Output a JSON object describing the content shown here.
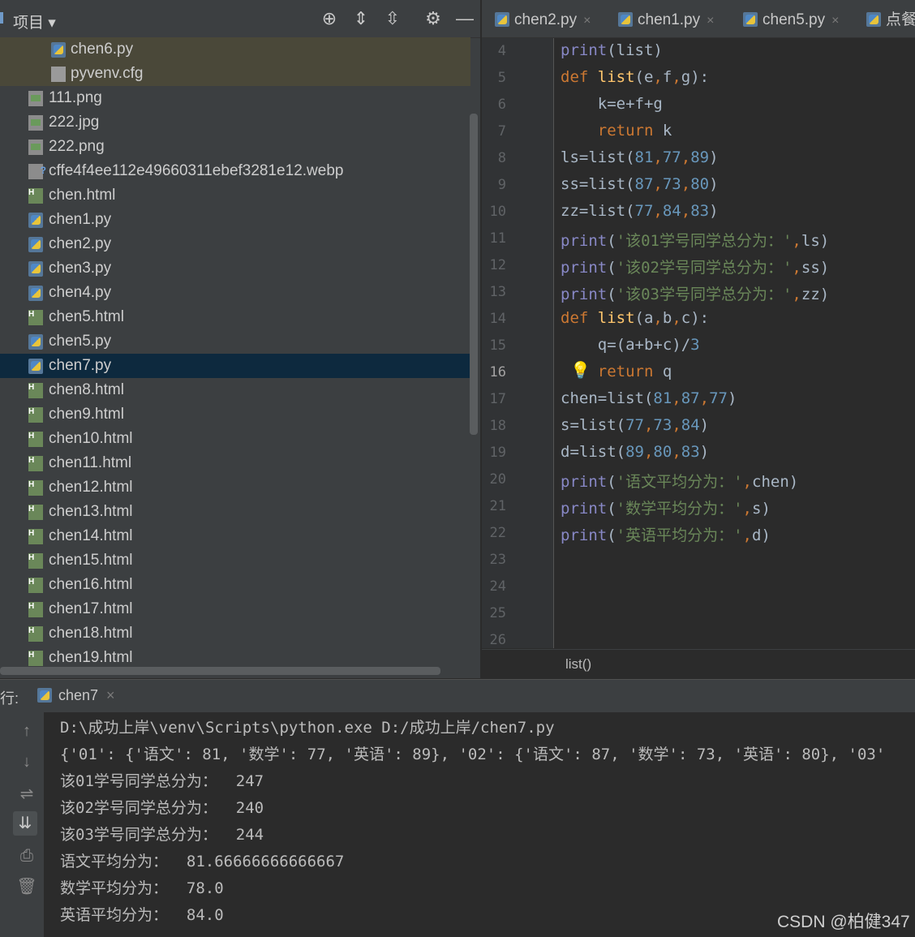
{
  "project": {
    "title": "项目 ▾",
    "files": [
      {
        "name": "chen6.py",
        "type": "py",
        "indent": 1
      },
      {
        "name": "pyvenv.cfg",
        "type": "cfg",
        "indent": 1
      },
      {
        "name": "111.png",
        "type": "img",
        "indent": 0
      },
      {
        "name": "222.jpg",
        "type": "img",
        "indent": 0
      },
      {
        "name": "222.png",
        "type": "img",
        "indent": 0
      },
      {
        "name": "cffe4f4ee112e49660311ebef3281e12.webp",
        "type": "unknown",
        "indent": 0
      },
      {
        "name": "chen.html",
        "type": "html",
        "indent": 0
      },
      {
        "name": "chen1.py",
        "type": "py",
        "indent": 0
      },
      {
        "name": "chen2.py",
        "type": "py",
        "indent": 0
      },
      {
        "name": "chen3.py",
        "type": "py",
        "indent": 0
      },
      {
        "name": "chen4.py",
        "type": "py",
        "indent": 0
      },
      {
        "name": "chen5.html",
        "type": "html",
        "indent": 0
      },
      {
        "name": "chen5.py",
        "type": "py",
        "indent": 0
      },
      {
        "name": "chen7.py",
        "type": "py",
        "indent": 0,
        "selected": true
      },
      {
        "name": "chen8.html",
        "type": "html",
        "indent": 0
      },
      {
        "name": "chen9.html",
        "type": "html",
        "indent": 0
      },
      {
        "name": "chen10.html",
        "type": "html",
        "indent": 0
      },
      {
        "name": "chen11.html",
        "type": "html",
        "indent": 0
      },
      {
        "name": "chen12.html",
        "type": "html",
        "indent": 0
      },
      {
        "name": "chen13.html",
        "type": "html",
        "indent": 0
      },
      {
        "name": "chen14.html",
        "type": "html",
        "indent": 0
      },
      {
        "name": "chen15.html",
        "type": "html",
        "indent": 0
      },
      {
        "name": "chen16.html",
        "type": "html",
        "indent": 0
      },
      {
        "name": "chen17.html",
        "type": "html",
        "indent": 0
      },
      {
        "name": "chen18.html",
        "type": "html",
        "indent": 0
      },
      {
        "name": "chen19.html",
        "type": "html",
        "indent": 0
      }
    ]
  },
  "tabs": [
    {
      "label": "chen2.py",
      "close": "×"
    },
    {
      "label": "chen1.py",
      "close": "×"
    },
    {
      "label": "chen5.py",
      "close": "×"
    },
    {
      "label": "点餐",
      "close": ""
    }
  ],
  "editor": {
    "line_numbers": [
      "4",
      "5",
      "6",
      "7",
      "8",
      "9",
      "10",
      "11",
      "12",
      "13",
      "14",
      "15",
      "16",
      "17",
      "18",
      "19",
      "20",
      "21",
      "22",
      "23",
      "24",
      "25",
      "26"
    ],
    "current_line": "16",
    "lines": [
      [
        {
          "t": "print",
          "c": "bi"
        },
        {
          "t": "(list)",
          "c": ""
        }
      ],
      [
        {
          "t": "def ",
          "c": "kw"
        },
        {
          "t": "list",
          "c": "fn"
        },
        {
          "t": "(e",
          "c": ""
        },
        {
          "t": ",",
          "c": "kw"
        },
        {
          "t": "f",
          "c": ""
        },
        {
          "t": ",",
          "c": "kw"
        },
        {
          "t": "g):",
          "c": ""
        }
      ],
      [
        {
          "t": "    k=e+f+g",
          "c": ""
        }
      ],
      [
        {
          "t": "    ",
          "c": ""
        },
        {
          "t": "return ",
          "c": "kw"
        },
        {
          "t": "k",
          "c": ""
        }
      ],
      [
        {
          "t": "ls=list(",
          "c": ""
        },
        {
          "t": "81",
          "c": "num"
        },
        {
          "t": ",",
          "c": "kw"
        },
        {
          "t": "77",
          "c": "num"
        },
        {
          "t": ",",
          "c": "kw"
        },
        {
          "t": "89",
          "c": "num"
        },
        {
          "t": ")",
          "c": ""
        }
      ],
      [
        {
          "t": "ss=list(",
          "c": ""
        },
        {
          "t": "87",
          "c": "num"
        },
        {
          "t": ",",
          "c": "kw"
        },
        {
          "t": "73",
          "c": "num"
        },
        {
          "t": ",",
          "c": "kw"
        },
        {
          "t": "80",
          "c": "num"
        },
        {
          "t": ")",
          "c": ""
        }
      ],
      [
        {
          "t": "zz=list(",
          "c": ""
        },
        {
          "t": "77",
          "c": "num"
        },
        {
          "t": ",",
          "c": "kw"
        },
        {
          "t": "84",
          "c": "num"
        },
        {
          "t": ",",
          "c": "kw"
        },
        {
          "t": "83",
          "c": "num"
        },
        {
          "t": ")",
          "c": ""
        }
      ],
      [
        {
          "t": "print",
          "c": "bi"
        },
        {
          "t": "(",
          "c": ""
        },
        {
          "t": "'该01学号同学总分为：'",
          "c": "str"
        },
        {
          "t": ",",
          "c": "kw"
        },
        {
          "t": "ls)",
          "c": ""
        }
      ],
      [
        {
          "t": "print",
          "c": "bi"
        },
        {
          "t": "(",
          "c": ""
        },
        {
          "t": "'该02学号同学总分为：'",
          "c": "str"
        },
        {
          "t": ",",
          "c": "kw"
        },
        {
          "t": "ss)",
          "c": ""
        }
      ],
      [
        {
          "t": "print",
          "c": "bi"
        },
        {
          "t": "(",
          "c": ""
        },
        {
          "t": "'该03学号同学总分为：'",
          "c": "str"
        },
        {
          "t": ",",
          "c": "kw"
        },
        {
          "t": "zz)",
          "c": ""
        }
      ],
      [
        {
          "t": "def ",
          "c": "kw"
        },
        {
          "t": "list",
          "c": "fn"
        },
        {
          "t": "(a",
          "c": ""
        },
        {
          "t": ",",
          "c": "kw"
        },
        {
          "t": "b",
          "c": ""
        },
        {
          "t": ",",
          "c": "kw"
        },
        {
          "t": "c):",
          "c": ""
        }
      ],
      [
        {
          "t": "    q=(a+b+c)/",
          "c": ""
        },
        {
          "t": "3",
          "c": "num"
        }
      ],
      [
        {
          "t": "    ",
          "c": ""
        },
        {
          "t": "return ",
          "c": "kw"
        },
        {
          "t": "q",
          "c": ""
        }
      ],
      [
        {
          "t": "chen=list(",
          "c": ""
        },
        {
          "t": "81",
          "c": "num"
        },
        {
          "t": ",",
          "c": "kw"
        },
        {
          "t": "87",
          "c": "num"
        },
        {
          "t": ",",
          "c": "kw"
        },
        {
          "t": "77",
          "c": "num"
        },
        {
          "t": ")",
          "c": ""
        }
      ],
      [
        {
          "t": "s=list(",
          "c": ""
        },
        {
          "t": "77",
          "c": "num"
        },
        {
          "t": ",",
          "c": "kw"
        },
        {
          "t": "73",
          "c": "num"
        },
        {
          "t": ",",
          "c": "kw"
        },
        {
          "t": "84",
          "c": "num"
        },
        {
          "t": ")",
          "c": ""
        }
      ],
      [
        {
          "t": "d=list(",
          "c": ""
        },
        {
          "t": "89",
          "c": "num"
        },
        {
          "t": ",",
          "c": "kw"
        },
        {
          "t": "80",
          "c": "num"
        },
        {
          "t": ",",
          "c": "kw"
        },
        {
          "t": "83",
          "c": "num"
        },
        {
          "t": ")",
          "c": ""
        }
      ],
      [
        {
          "t": "print",
          "c": "bi"
        },
        {
          "t": "(",
          "c": ""
        },
        {
          "t": "'语文平均分为：'",
          "c": "str"
        },
        {
          "t": ",",
          "c": "kw"
        },
        {
          "t": "chen)",
          "c": ""
        }
      ],
      [
        {
          "t": "print",
          "c": "bi"
        },
        {
          "t": "(",
          "c": ""
        },
        {
          "t": "'数学平均分为：'",
          "c": "str"
        },
        {
          "t": ",",
          "c": "kw"
        },
        {
          "t": "s)",
          "c": ""
        }
      ],
      [
        {
          "t": "print",
          "c": "bi"
        },
        {
          "t": "(",
          "c": ""
        },
        {
          "t": "'英语平均分为：'",
          "c": "str"
        },
        {
          "t": ",",
          "c": "kw"
        },
        {
          "t": "d)",
          "c": ""
        }
      ]
    ],
    "breadcrumb": "list()"
  },
  "run": {
    "label": "行:",
    "tab": "chen7",
    "tab_close": "×",
    "output": [
      "D:\\成功上岸\\venv\\Scripts\\python.exe D:/成功上岸/chen7.py",
      "{'01': {'语文': 81, '数学': 77, '英语': 89}, '02': {'语文': 87, '数学': 73, '英语': 80}, '03'",
      "该01学号同学总分为：  247",
      "该02学号同学总分为：  240",
      "该03学号同学总分为：  244",
      "语文平均分为：  81.66666666666667",
      "数学平均分为：  78.0",
      "英语平均分为：  84.0"
    ]
  },
  "watermark": "CSDN @柏健347",
  "colors": {
    "bg": "#2b2b2b",
    "panel": "#3c3f41",
    "selected": "#0d293e",
    "keyword": "#cc7832",
    "string": "#6a8759",
    "number": "#6897bb"
  }
}
